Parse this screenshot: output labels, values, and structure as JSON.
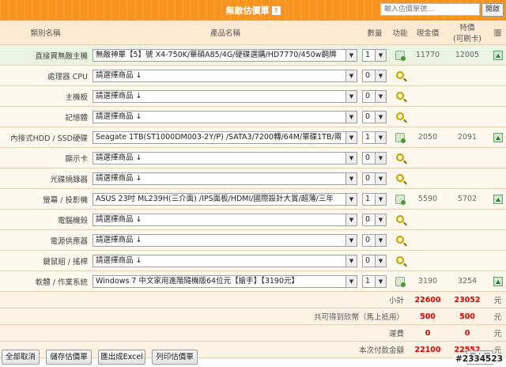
{
  "header": {
    "title": "無敵估價單",
    "help_icon": "?",
    "search_placeholder": "輸入估價單號...",
    "open_label": "開啟"
  },
  "columns": {
    "category": "類別名稱",
    "product": "產品名稱",
    "qty": "數量",
    "function": "功能",
    "cash": "現金價",
    "special": "特價",
    "special_sub": "(可刷卡)",
    "image": "圖"
  },
  "rows": [
    {
      "category": "直接買無敵主機",
      "product": "無敵神單【5】號 X4-750K/華碩A85/4G/硬碟選購/HD7770/450w鋼牌",
      "qty": "1",
      "function_icon": "cart-icon",
      "cash": "11770",
      "special": "12005",
      "has_image": true
    },
    {
      "category": "處理器 CPU",
      "product": "請選擇商品 ↓",
      "qty": "0",
      "function_icon": "magnifier-icon",
      "cash": "",
      "special": "",
      "has_image": false
    },
    {
      "category": "主機板",
      "product": "請選擇商品 ↓",
      "qty": "0",
      "function_icon": "magnifier-icon",
      "cash": "",
      "special": "",
      "has_image": false
    },
    {
      "category": "記憶體",
      "product": "請選擇商品 ↓",
      "qty": "0",
      "function_icon": "magnifier-icon",
      "cash": "",
      "special": "",
      "has_image": false
    },
    {
      "category": "內接式HDD / SSD硬碟",
      "product": "Seagate 1TB(ST1000DM003-2Y/P) /SATA3/7200轉/64M/單碟1TB/兩",
      "qty": "1",
      "function_icon": "cart-icon",
      "cash": "2050",
      "special": "2091",
      "has_image": true
    },
    {
      "category": "顯示卡",
      "product": "請選擇商品 ↓",
      "qty": "0",
      "function_icon": "magnifier-icon",
      "cash": "",
      "special": "",
      "has_image": false
    },
    {
      "category": "光碟燒錄器",
      "product": "請選擇商品 ↓",
      "qty": "0",
      "function_icon": "magnifier-icon",
      "cash": "",
      "special": "",
      "has_image": false
    },
    {
      "category": "螢幕 / 投影機",
      "product": "ASUS 23吋 ML239H(三介面) /IPS面板/HDMI/國際設計大賞/超薄/三年",
      "qty": "1",
      "function_icon": "cart-icon",
      "cash": "5590",
      "special": "5702",
      "has_image": true
    },
    {
      "category": "電腦機殼",
      "product": "請選擇商品 ↓",
      "qty": "0",
      "function_icon": "magnifier-icon",
      "cash": "",
      "special": "",
      "has_image": false
    },
    {
      "category": "電源供應器",
      "product": "請選擇商品 ↓",
      "qty": "0",
      "function_icon": "magnifier-icon",
      "cash": "",
      "special": "",
      "has_image": false
    },
    {
      "category": "鍵鼠組 / 搖桿",
      "product": "請選擇商品 ↓",
      "qty": "0",
      "function_icon": "magnifier-icon",
      "cash": "",
      "special": "",
      "has_image": false
    },
    {
      "category": "軟體 / 作業系統",
      "product": "Windows 7 中文家用進階隨機版64位元【搶手】【3190元】",
      "qty": "1",
      "function_icon": "cart-icon",
      "cash": "3190",
      "special": "3254",
      "has_image": true
    }
  ],
  "summary": [
    {
      "label": "小計",
      "cash": "22600",
      "special": "23052",
      "unit": "元"
    },
    {
      "label": "共可得到欣幣（馬上抵用）",
      "cash": "500",
      "special": "500",
      "unit": "元"
    },
    {
      "label": "運費",
      "cash": "0",
      "special": "0",
      "unit": "元"
    },
    {
      "label": "本次付款金額",
      "cash": "22100",
      "special": "22552",
      "unit": "元"
    }
  ],
  "buttons": {
    "clear_all": "全部取消",
    "save": "儲存估價單",
    "export_excel": "匯出成Excel",
    "print": "列印估價單",
    "more": "馬上買"
  },
  "watermark": "#2334523",
  "colors": {
    "header_orange": "#f7941d",
    "header_row": "#fcead2",
    "row_bg": "#fff8ee",
    "first_row_bg": "#e9f4e2",
    "total_red": "#dd0000"
  }
}
